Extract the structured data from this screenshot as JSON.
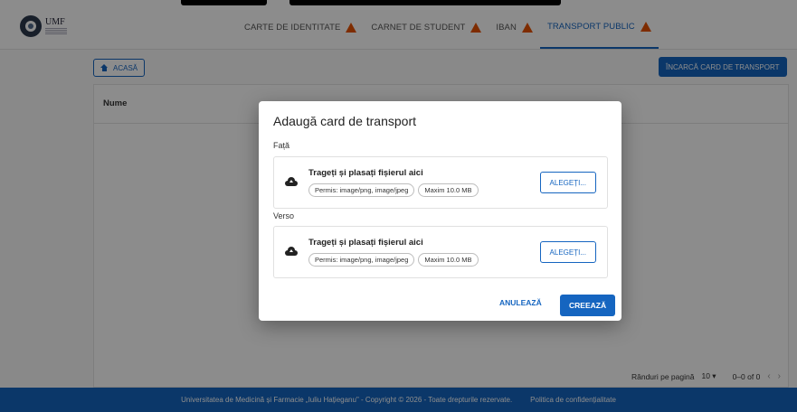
{
  "header": {
    "logo_text": "UMF",
    "tabs": [
      {
        "label": "CARTE DE IDENTITATE",
        "warning": true
      },
      {
        "label": "CARNET DE STUDENT",
        "warning": true
      },
      {
        "label": "IBAN",
        "warning": true
      },
      {
        "label": "TRANSPORT PUBLIC",
        "warning": true,
        "active": true
      }
    ]
  },
  "main": {
    "home_label": "ACASĂ",
    "upload_label": "ÎNCARCĂ CARD DE TRANSPORT",
    "columns": [
      "Nume"
    ],
    "pager": {
      "rows_per_page_label": "Rânduri pe pagină",
      "rows_per_page": "10",
      "range": "0–0 of 0"
    }
  },
  "footer": {
    "copyright": "Universitatea de Medicină și Farmacie „Iuliu Hațieganu\" - Copyright © 2026 - Toate drepturile rezervate.",
    "privacy": "Politica de confidențialitate"
  },
  "dialog": {
    "title": "Adaugă card de transport",
    "sections": [
      {
        "label": "Față",
        "drop_text": "Trageți și plasați fișierul aici",
        "allowed": "Permis: image/png, image/jpeg",
        "max": "Maxim 10.0 MB",
        "choose_label": "ALEGEȚI..."
      },
      {
        "label": "Verso",
        "drop_text": "Trageți și plasați fișierul aici",
        "allowed": "Permis: image/png, image/jpeg",
        "max": "Maxim 10.0 MB",
        "choose_label": "ALEGEȚI..."
      }
    ],
    "cancel_label": "ANULEAZĂ",
    "create_label": "CREEAZĂ"
  },
  "colors": {
    "accent": "#1565c0",
    "warning": "#e65100",
    "overlay": "rgba(0,0,0,0.45)"
  }
}
